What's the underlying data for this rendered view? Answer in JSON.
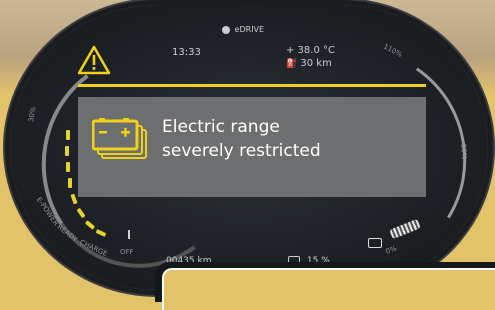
{
  "status_bar": {
    "time": "13:33",
    "mode": "eDRIVE",
    "temperature": "+ 38.0 °C",
    "range": "30 km"
  },
  "left_gauge": {
    "labels": [
      "30%",
      "E-POWER",
      "READY",
      "CHARGE",
      "OFF"
    ]
  },
  "right_gauge": {
    "labels": [
      "110%",
      "50%",
      "0%"
    ]
  },
  "alert": {
    "message_line1": "Electric range",
    "message_line2": "severely restricted",
    "accent_color": "#f1d21a",
    "box_color": "#6c6e70",
    "icon": "battery-warning-icon"
  },
  "bottom_bar": {
    "odometer": "00435 km",
    "fuel_percent": "15 %"
  }
}
